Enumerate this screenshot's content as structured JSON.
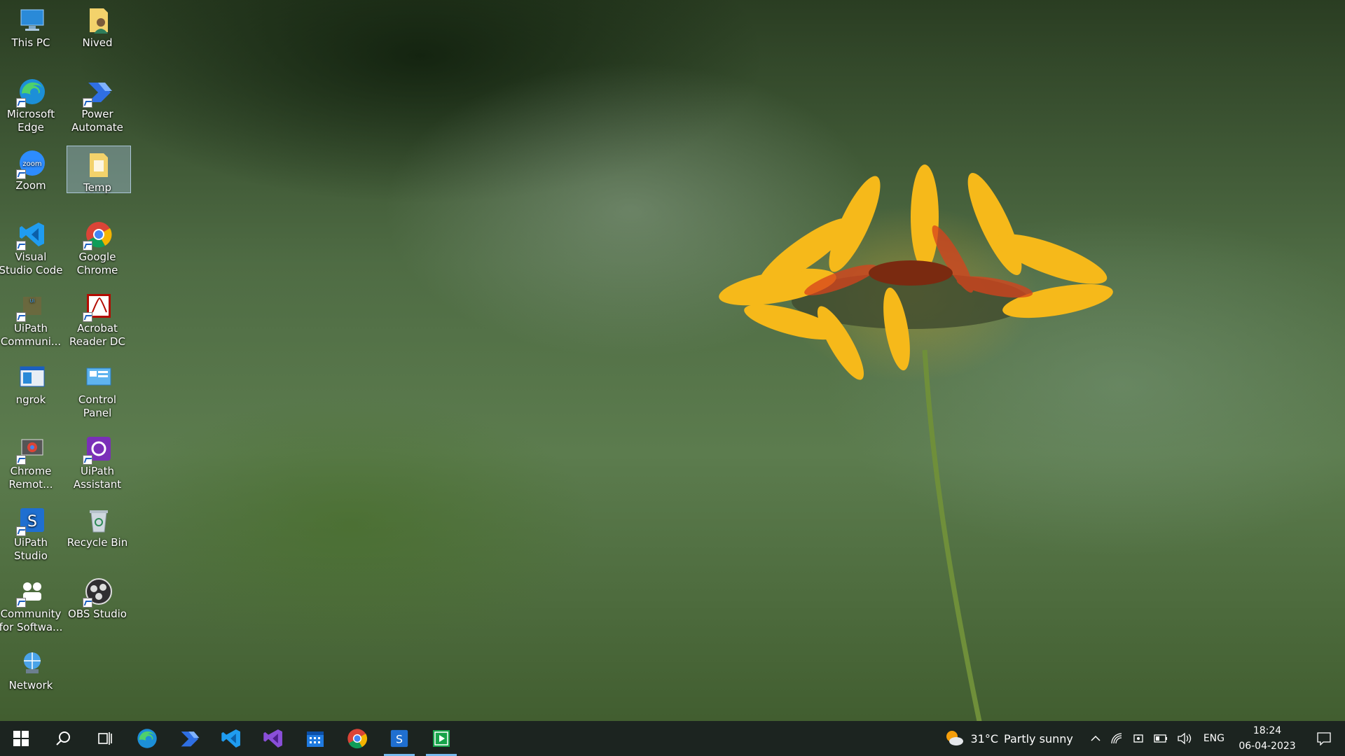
{
  "desktop": {
    "icons": [
      {
        "label": "This PC",
        "icon": "this-pc-icon"
      },
      {
        "label": "Nived",
        "icon": "user-folder-icon"
      },
      {
        "label": "Microsoft Edge",
        "icon": "edge-icon"
      },
      {
        "label": "Power Automate",
        "icon": "power-automate-icon"
      },
      {
        "label": "Zoom",
        "icon": "zoom-icon"
      },
      {
        "label": "Temp",
        "icon": "temp-folder-icon",
        "selected": true
      },
      {
        "label": "Visual Studio Code",
        "icon": "vscode-icon"
      },
      {
        "label": "Google Chrome",
        "icon": "chrome-icon"
      },
      {
        "label": "UiPath Communi...",
        "icon": "uipath-community-icon"
      },
      {
        "label": "Acrobat Reader DC",
        "icon": "acrobat-icon"
      },
      {
        "label": "ngrok",
        "icon": "ngrok-icon"
      },
      {
        "label": "Control Panel",
        "icon": "control-panel-icon"
      },
      {
        "label": "Chrome Remot...",
        "icon": "chrome-remote-icon"
      },
      {
        "label": "UiPath Assistant",
        "icon": "uipath-assistant-icon"
      },
      {
        "label": "UiPath Studio",
        "icon": "uipath-studio-icon"
      },
      {
        "label": "Recycle Bin",
        "icon": "recycle-bin-icon"
      },
      {
        "label": "Community for Softwa...",
        "icon": "community-icon"
      },
      {
        "label": "OBS Studio",
        "icon": "obs-icon"
      },
      {
        "label": "Network",
        "icon": "network-icon"
      }
    ]
  },
  "taskbar": {
    "apps": [
      {
        "name": "start",
        "icon": "windows-icon"
      },
      {
        "name": "search",
        "icon": "search-icon"
      },
      {
        "name": "task-view",
        "icon": "task-view-icon"
      },
      {
        "name": "edge",
        "icon": "edge-icon"
      },
      {
        "name": "power-automate",
        "icon": "power-automate-icon"
      },
      {
        "name": "vscode",
        "icon": "vscode-icon"
      },
      {
        "name": "visual-studio",
        "icon": "visual-studio-icon"
      },
      {
        "name": "calendar",
        "icon": "calendar-icon"
      },
      {
        "name": "chrome",
        "icon": "chrome-icon"
      },
      {
        "name": "uipath-studio",
        "icon": "uipath-studio-icon",
        "running": true
      },
      {
        "name": "media-player",
        "icon": "media-player-icon",
        "running": true
      }
    ],
    "weather": {
      "temp": "31°C",
      "condition": "Partly sunny"
    },
    "language": "ENG",
    "time": "18:24",
    "date": "06-04-2023"
  },
  "colors": {
    "taskbar": "#1c2420",
    "accent": "#76b9ed"
  }
}
